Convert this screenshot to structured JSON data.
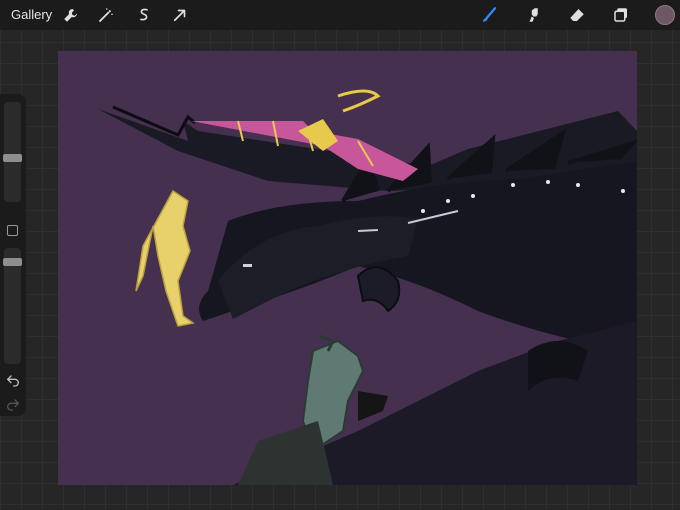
{
  "topbar": {
    "gallery_label": "Gallery",
    "left_tools": [
      {
        "icon": "wrench-icon"
      },
      {
        "icon": "magic-wand-icon"
      },
      {
        "icon": "selection-icon"
      },
      {
        "icon": "transform-arrow-icon"
      }
    ],
    "right_tools": [
      {
        "icon": "brush-icon",
        "active": true
      },
      {
        "icon": "smudge-icon"
      },
      {
        "icon": "eraser-icon"
      },
      {
        "icon": "layers-icon"
      }
    ],
    "active_color": "#6e5868"
  },
  "sidebar": {
    "brush_size_icon": "brush-size-slider",
    "opacity_icon": "opacity-slider",
    "modify_button": "square-modify-icon",
    "undo_icon": "undo-icon",
    "redo_icon": "redo-icon"
  },
  "canvas": {
    "background": "#45304f",
    "artwork": "dragon-illustration"
  },
  "colors": {
    "accent": "#2f8cff",
    "bar": "#1b1b1b"
  }
}
